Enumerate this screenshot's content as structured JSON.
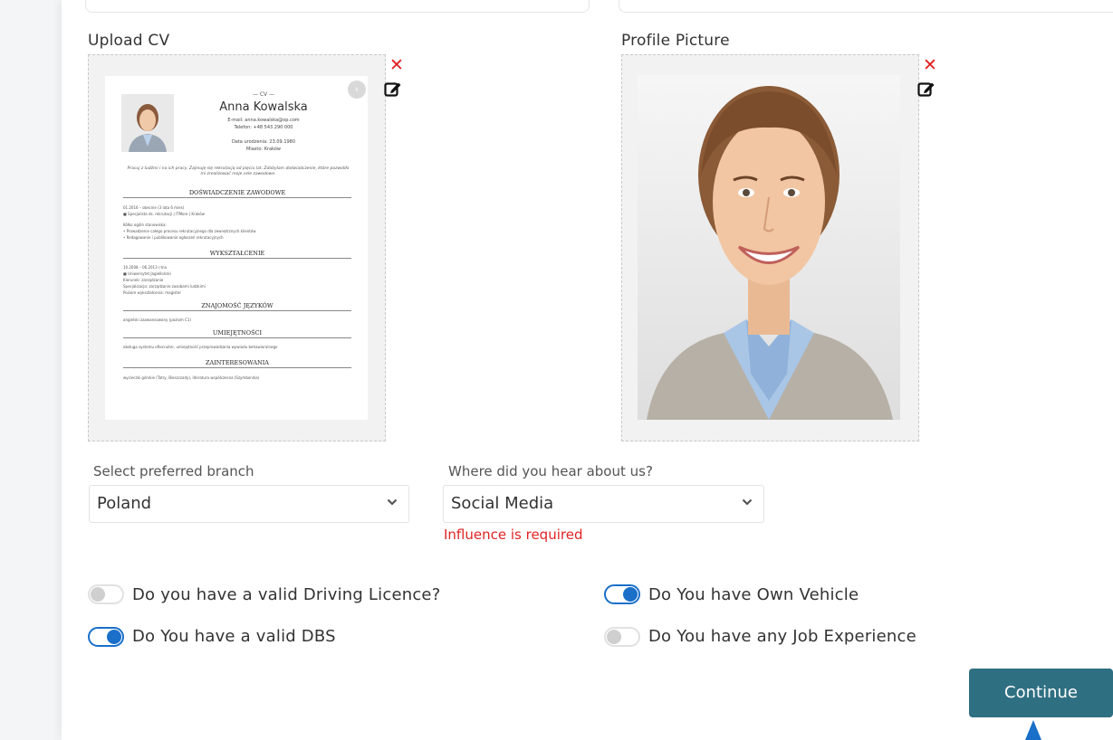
{
  "uploads": {
    "cv_label": "Upload CV",
    "profile_label": "Profile Picture"
  },
  "cv_document": {
    "tag": "— CV —",
    "name": "Anna Kowalska",
    "email": "E-mail: anna.kowalska@op.com",
    "phone": "Telefon: +48 543 290 000",
    "birth": "Data urodzenia: 23.09.1980",
    "city": "Miasto: Kraków",
    "intro": "Pracuj z ludźmi i na ich pracy. Zajmuję się rekrutacją od pięciu lat. Zdobyłam doświadczenie, które pozwoliło mi zrealizować moje cele zawodowe.",
    "sections": {
      "experience": "DOŚWIADCZENIE ZAWODOWE",
      "education": "WYKSZTAŁCENIE",
      "languages": "ZNAJOMOŚĆ JĘZYKÓW",
      "skills": "UMIEJĘTNOŚCI",
      "interests": "ZAINTERESOWANIA"
    },
    "rows": {
      "exp_1": "01.2016 – obecnie (3 lata 6 mies)",
      "exp_2": "■ Specjalista ds. rekrutacji | ITMore | Kraków",
      "exp_3": "Kółko ogóln stanowiska:",
      "exp_4": "• Prowadzenie całego procesu rekrutacyjnego dla zewnętrznych klientów",
      "exp_5": "• Redagowanie i publikowanie ogłoszeń rekrutacyjnych",
      "edu_1": "10.2008 – 06.2013 r.tna",
      "edu_2": "■ Uniwersytet Jagielloński",
      "edu_3": "Kierunek: zarządzanie",
      "edu_4": "Specjalizacja: zarządzanie zasobami ludzkimi",
      "edu_5": "Poziom wykształcenia: magister",
      "lang_1": "angielski zaawansowany (poziom C1)",
      "skill_1": "obsługa systemu eRecruiter, umiejętność przeprowadzania wywiadu behawioralnego",
      "int_1": "wycieczki górskie (Tatry, Bieszczady), literatura współczesna (Szymborska)"
    }
  },
  "form": {
    "branch_label": "Select preferred branch",
    "branch_value": "Poland",
    "source_label": "Where did you hear about us?",
    "source_value": "Social Media",
    "source_error": "Influence is required"
  },
  "toggles": {
    "driving_licence": {
      "label": "Do you have a valid Driving Licence?",
      "checked": false
    },
    "own_vehicle": {
      "label": "Do You have Own Vehicle",
      "checked": true
    },
    "valid_dbs": {
      "label": "Do You have a valid DBS",
      "checked": true
    },
    "job_experience": {
      "label": "Do You have any Job Experience",
      "checked": false
    }
  },
  "actions": {
    "continue_label": "Continue"
  },
  "colors": {
    "accent": "#1a6fc9",
    "button": "#2f6f82",
    "error": "#e02424",
    "remove": "#e0201f"
  }
}
